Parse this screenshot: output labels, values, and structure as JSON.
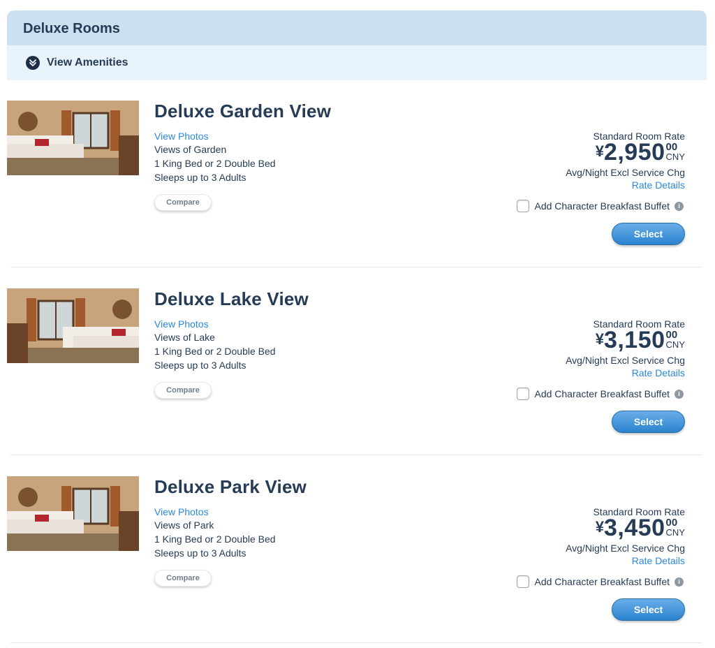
{
  "section": {
    "title": "Deluxe Rooms"
  },
  "amenities": {
    "label": "View Amenities",
    "icon": "double-chevron-down-icon"
  },
  "rooms": [
    {
      "name": "Deluxe Garden View",
      "view_photos": "View Photos",
      "details": [
        "Views of Garden",
        "1 King Bed or 2 Double Bed",
        "Sleeps up to 3 Adults"
      ],
      "compare": "Compare",
      "rate_label": "Standard Room Rate",
      "currency_symbol": "¥",
      "amount": "2,950",
      "cents": "00",
      "currency": "CNY",
      "per_night": "Avg/Night Excl Service Chg",
      "rate_details": "Rate Details",
      "breakfast": "Add Character Breakfast Buffet",
      "select": "Select"
    },
    {
      "name": "Deluxe Lake View",
      "view_photos": "View Photos",
      "details": [
        "Views of Lake",
        "1 King Bed or 2 Double Bed",
        "Sleeps up to 3 Adults"
      ],
      "compare": "Compare",
      "rate_label": "Standard Room Rate",
      "currency_symbol": "¥",
      "amount": "3,150",
      "cents": "00",
      "currency": "CNY",
      "per_night": "Avg/Night Excl Service Chg",
      "rate_details": "Rate Details",
      "breakfast": "Add Character Breakfast Buffet",
      "select": "Select"
    },
    {
      "name": "Deluxe Park View",
      "view_photos": "View Photos",
      "details": [
        "Views of Park",
        "1 King Bed or 2 Double Bed",
        "Sleeps up to 3 Adults"
      ],
      "compare": "Compare",
      "rate_label": "Standard Room Rate",
      "currency_symbol": "¥",
      "amount": "3,450",
      "cents": "00",
      "currency": "CNY",
      "per_night": "Avg/Night Excl Service Chg",
      "rate_details": "Rate Details",
      "breakfast": "Add Character Breakfast Buffet",
      "select": "Select"
    }
  ],
  "colors": {
    "header_bg": "#cde0f0",
    "amenities_bg": "#e9f3fb",
    "text": "#253b56",
    "link": "#2b88d8",
    "button": "#2b83cf"
  },
  "info_icon": "info-icon"
}
